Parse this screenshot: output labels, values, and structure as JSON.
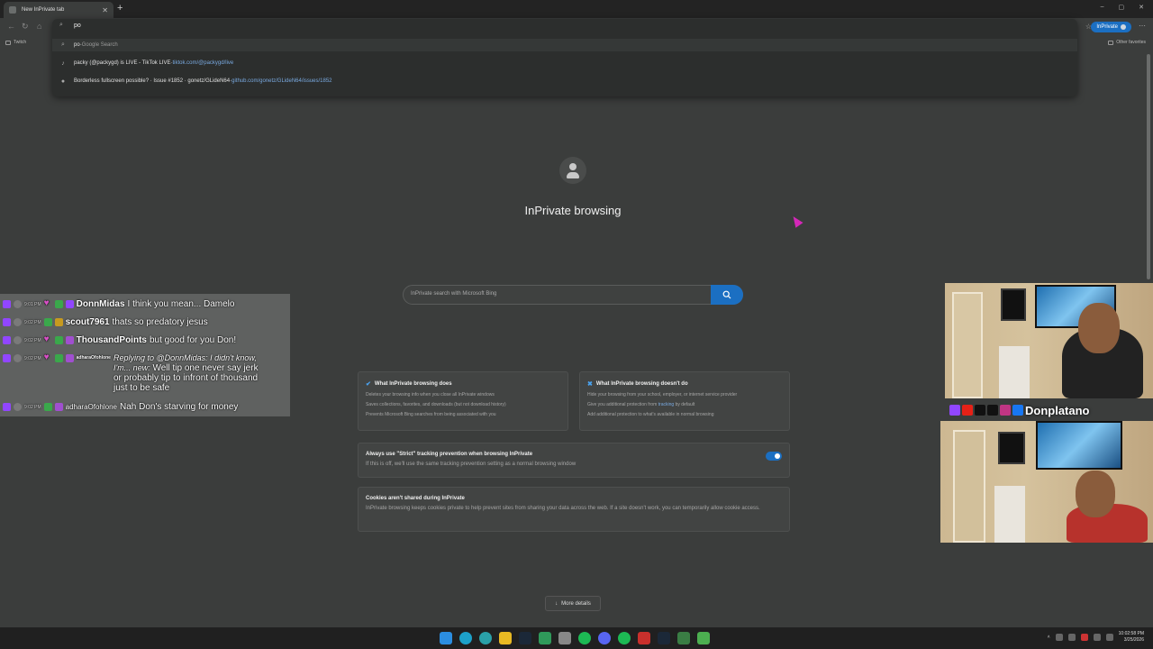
{
  "browser": {
    "tab_title": "New InPrivate tab",
    "new_tab": "+",
    "window_controls": [
      "–",
      "▢",
      "✕"
    ],
    "address_value": "po",
    "inprivate_label": "InPrivate",
    "favorites": {
      "twitch": "Twitch",
      "other": "Other favorites"
    }
  },
  "omnibox": {
    "suggestions": [
      {
        "query": "po",
        "sep": " - ",
        "source": "Google Search"
      },
      {
        "title": "packy (@packygd) is LIVE - TikTok LIVE",
        "sep": " - ",
        "url": "tiktok.com/@packygd/live"
      },
      {
        "title": "Borderless fullscreen possible? · Issue #1852 · gonetz/GLideN64",
        "sep": " - ",
        "url": "github.com/gonetz/GLideN64/issues/1852"
      }
    ]
  },
  "page": {
    "title": "InPrivate browsing",
    "search_placeholder": "InPrivate search with Microsoft Bing",
    "does": {
      "title": "What InPrivate browsing does",
      "lines": [
        "Deletes your browsing info when you close all InPrivate windows",
        "Saves collections, favorites, and downloads (but not download history)",
        "Prevents Microsoft Bing searches from being associated with you"
      ]
    },
    "doesnt": {
      "title": "What InPrivate browsing doesn't do",
      "lines": [
        "Hide your browsing from your school, employer, or internet service provider",
        "Give you additional protection from",
        "tracking",
        "by default",
        "Add additional protection to what's available in normal browsing"
      ]
    },
    "strict": {
      "title": "Always use \"Strict\" tracking prevention when browsing InPrivate",
      "desc": "If this is off, we'll use the same tracking prevention setting as a normal browsing window",
      "enabled": true
    },
    "cookies": {
      "title": "Cookies aren't shared during InPrivate",
      "desc": "InPrivate browsing keeps cookies private to help prevent sites from sharing your data across the web. If a site doesn't work, you can temporarily allow cookie access."
    },
    "more_details": "More details"
  },
  "chat": [
    {
      "time": "9:01 PM",
      "name": "DonnMidas",
      "text": "I think you mean... Damelo"
    },
    {
      "time": "9:02 PM",
      "name": "scout7961",
      "text": "thats so predatory jesus"
    },
    {
      "time": "9:02 PM",
      "name": "ThousandPoints",
      "text": "but good for you Don!"
    },
    {
      "time": "9:02 PM",
      "name": "adharaOfohlone",
      "reply": "Replying to @DonnMidas: I didn't know, I'm... new:",
      "text": "Well tip one never say jerk or probably tip to infront of thousand just to be safe"
    },
    {
      "time": "9:02 PM",
      "name": "adharaOfohlone",
      "text": "Nah Don's starving for money"
    }
  ],
  "stream_banner": "Donplatano",
  "clock": {
    "time": "10:02:58 PM",
    "date": "3/25/2026"
  },
  "colors": {
    "accent": "#1b6fc2",
    "bg": "#3b3d3c"
  }
}
